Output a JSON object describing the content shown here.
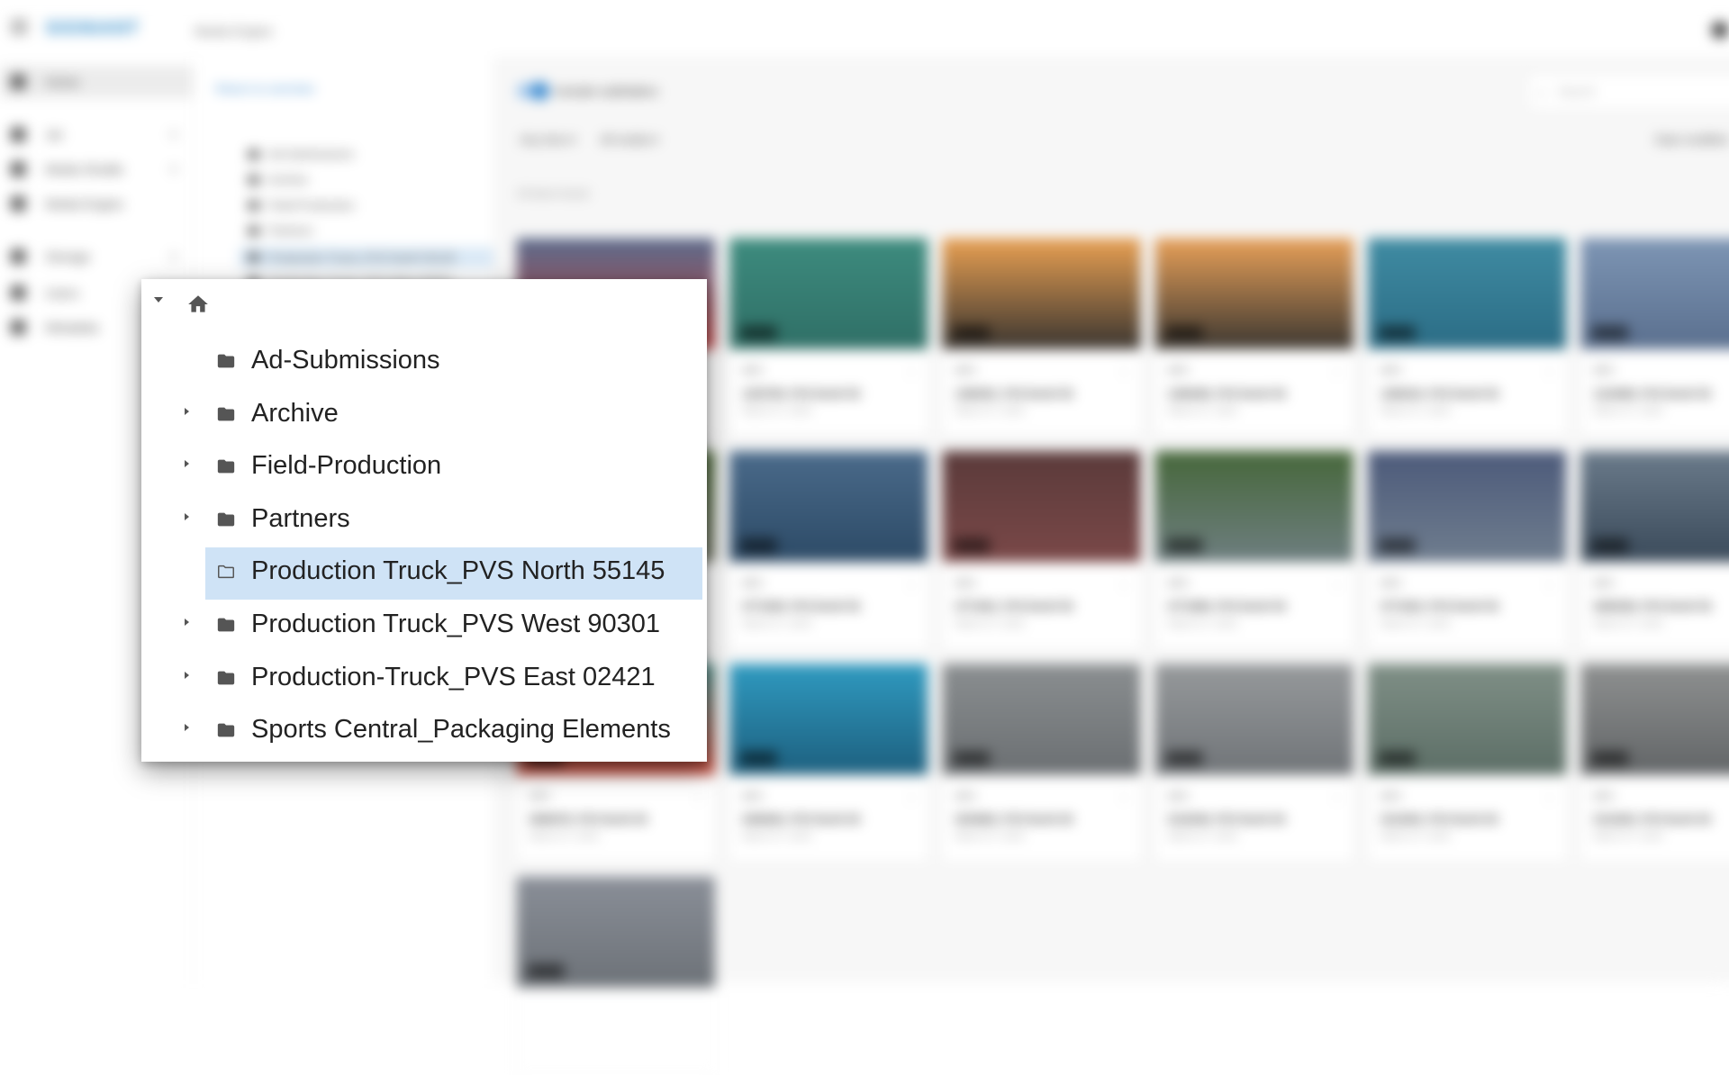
{
  "app": {
    "brand": "SIGNIANT",
    "title": "Media Engine",
    "user_icon": "user-avatar-icon"
  },
  "sidebar": {
    "items": [
      {
        "label": "Home",
        "icon": "home-icon",
        "active": true
      },
      {
        "label": "Jet",
        "icon": "jet-icon",
        "expandable": true
      },
      {
        "label": "Media Shuttle",
        "icon": "shuttle-icon",
        "expandable": true
      },
      {
        "label": "Media Engine",
        "icon": "engine-icon"
      },
      {
        "label": "Storage",
        "icon": "storage-icon",
        "expandable": true
      },
      {
        "label": "Users",
        "icon": "users-icon"
      },
      {
        "label": "Metadata",
        "icon": "metadata-icon"
      }
    ]
  },
  "tree_panel": {
    "return_label": "Return to overview",
    "items": [
      "Ad-Submissions",
      "Archive",
      "Field-Production",
      "Partners",
      "Production Truck_PVS North 55145",
      "Production Truck_PVS West 90301"
    ]
  },
  "toolbar": {
    "include_subfolders_label": "Include subfolders",
    "include_subfolders_on": true,
    "search_placeholder": "Search",
    "filter_time": "Any time",
    "filter_media": "All media",
    "sort_label": "Date modified"
  },
  "results": {
    "count_label": "19 items found"
  },
  "cards": [
    {
      "name": "1203764_PVS North 55",
      "date": "March 27, 2024",
      "duration": "00:28",
      "meta": "MP4",
      "colors": [
        "#5a6a8a",
        "#c24545"
      ]
    },
    {
      "name": "1203769_PVS North 55",
      "date": "March 27, 2024",
      "duration": "00:28",
      "meta": "MP4",
      "colors": [
        "#3d8b7e",
        "#2f6f66"
      ]
    },
    {
      "name": "1280291_PVS North 55",
      "date": "March 27, 2024",
      "duration": "00:28",
      "meta": "MP4",
      "colors": [
        "#e9a052",
        "#3a3530"
      ]
    },
    {
      "name": "1280298_PVS North 55",
      "date": "March 27, 2024",
      "duration": "00:28",
      "meta": "MP4",
      "colors": [
        "#e8a058",
        "#3c3731"
      ]
    },
    {
      "name": "1280224_PVS North 55",
      "date": "March 27, 2024",
      "duration": "00:28",
      "meta": "MP4",
      "colors": [
        "#3f8ba2",
        "#2b6c85"
      ]
    },
    {
      "name": "1124098_PVS North 55",
      "date": "March 27, 2024",
      "duration": "00:28",
      "meta": "MP4",
      "colors": [
        "#7d95b4",
        "#5a6f8e"
      ]
    },
    {
      "name": "0771934_PVS North 55",
      "date": "March 27, 2024",
      "duration": "00:28",
      "meta": "MP4",
      "colors": [
        "#4f6b3c",
        "#7a7d6e"
      ]
    },
    {
      "name": "0771949_PVS North 55",
      "date": "March 27, 2024",
      "duration": "00:28",
      "meta": "MP4",
      "colors": [
        "#4a6a8a",
        "#2c4a66"
      ]
    },
    {
      "name": "0771941_PVS North 55",
      "date": "March 27, 2024",
      "duration": "00:28",
      "meta": "MP4",
      "colors": [
        "#5a3a3a",
        "#7a4848"
      ]
    },
    {
      "name": "0771898_PVS North 55",
      "date": "March 27, 2024",
      "duration": "00:28",
      "meta": "MP4",
      "colors": [
        "#46673a",
        "#6e7e80"
      ]
    },
    {
      "name": "0771923_PVS North 55",
      "date": "March 27, 2024",
      "duration": "00:28",
      "meta": "MP4",
      "colors": [
        "#4c5a7a",
        "#6f7d8e"
      ]
    },
    {
      "name": "0690258_PVS North 55",
      "date": "March 27, 2024",
      "duration": "00:28",
      "meta": "MP4",
      "colors": [
        "#6a7a8a",
        "#3a4a5a"
      ]
    },
    {
      "name": "0690078_PVS North 55",
      "date": "March 27, 2024",
      "duration": "00:28",
      "meta": "MP4",
      "colors": [
        "#4d8f8a",
        "#c84b3c"
      ]
    },
    {
      "name": "0460842_PVS North 55",
      "date": "March 27, 2024",
      "duration": "00:28",
      "meta": "MP4",
      "colors": [
        "#2f9ac0",
        "#1d5f7e"
      ]
    },
    {
      "name": "0204802_PVS North 55",
      "date": "March 27, 2024",
      "duration": "00:28",
      "meta": "MP4",
      "colors": [
        "#8a8e90",
        "#6b6f72"
      ]
    },
    {
      "name": "0110048_PVS North 55",
      "date": "March 27, 2024",
      "duration": "00:28",
      "meta": "MP4",
      "colors": [
        "#96999b",
        "#707478"
      ]
    },
    {
      "name": "0110402_PVS North 55",
      "date": "March 27, 2024",
      "duration": "00:28",
      "meta": "MP4",
      "colors": [
        "#7f8f86",
        "#5c6e66"
      ]
    },
    {
      "name": "0110425_PVS North 55",
      "date": "March 27, 2024",
      "duration": "00:28",
      "meta": "MP4",
      "colors": [
        "#8e9090",
        "#626567"
      ]
    },
    {
      "name": "0108822_PVS North 55",
      "date": "March 27, 2024",
      "duration": "00:28",
      "meta": "MP4",
      "colors": [
        "#8a8f98",
        "#6d7278"
      ]
    }
  ],
  "popup": {
    "root_icon": "home-icon",
    "items": [
      {
        "label": "Ad-Submissions",
        "expandable": false,
        "selected": false,
        "icon": "folder-icon"
      },
      {
        "label": "Archive",
        "expandable": true,
        "selected": false,
        "icon": "folder-icon"
      },
      {
        "label": "Field-Production",
        "expandable": true,
        "selected": false,
        "icon": "folder-icon"
      },
      {
        "label": "Partners",
        "expandable": true,
        "selected": false,
        "icon": "folder-icon"
      },
      {
        "label": "Production Truck_PVS North 55145",
        "expandable": false,
        "selected": true,
        "icon": "folder-open-outline-icon"
      },
      {
        "label": "Production Truck_PVS West 90301",
        "expandable": true,
        "selected": false,
        "icon": "folder-icon"
      },
      {
        "label": "Production-Truck_PVS East 02421",
        "expandable": true,
        "selected": false,
        "icon": "folder-icon"
      },
      {
        "label": "Sports Central_Packaging Elements",
        "expandable": true,
        "selected": false,
        "icon": "folder-icon"
      }
    ]
  },
  "colors": {
    "accent": "#3a8ad0",
    "selection": "#cfe3f6"
  }
}
